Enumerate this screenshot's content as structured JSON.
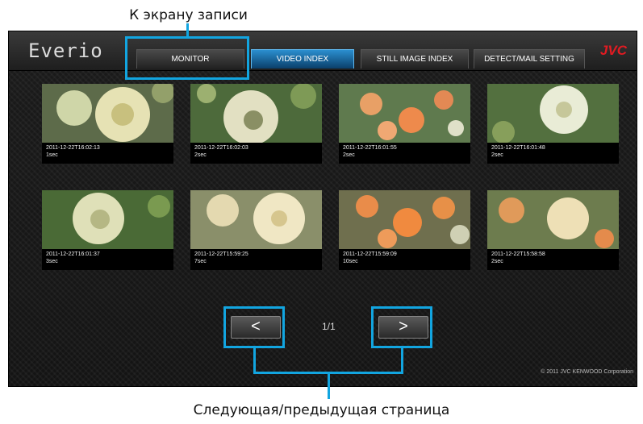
{
  "annotations": {
    "top_label": "К экрану записи",
    "bottom_label": "Следующая/предыдущая страница"
  },
  "app": {
    "logo": "Everio",
    "brand": "JVC",
    "tabs": [
      {
        "label": "MONITOR",
        "active": false
      },
      {
        "label": "VIDEO INDEX",
        "active": true
      },
      {
        "label": "STILL IMAGE INDEX",
        "active": false
      },
      {
        "label": "DETECT/MAIL SETTING",
        "active": false
      }
    ]
  },
  "thumbnails": [
    {
      "timestamp": "2011-12-22T16:02:13",
      "duration": "1sec"
    },
    {
      "timestamp": "2011-12-22T16:02:03",
      "duration": "2sec"
    },
    {
      "timestamp": "2011-12-22T16:01:55",
      "duration": "2sec"
    },
    {
      "timestamp": "2011-12-22T16:01:48",
      "duration": "2sec"
    },
    {
      "timestamp": "2011-12-22T16:01:37",
      "duration": "3sec"
    },
    {
      "timestamp": "2011-12-22T15:59:25",
      "duration": "7sec"
    },
    {
      "timestamp": "2011-12-22T15:59:09",
      "duration": "10sec"
    },
    {
      "timestamp": "2011-12-22T15:58:58",
      "duration": "2sec"
    }
  ],
  "pagination": {
    "prev_label": "<",
    "next_label": ">",
    "page": "1/1"
  },
  "footer": {
    "copyright": "© 2011 JVC KENWOOD Corporation"
  },
  "colors": {
    "highlight": "#12a5e0",
    "brand_red": "#e11b22",
    "active_tab": "#2b8fd0"
  }
}
